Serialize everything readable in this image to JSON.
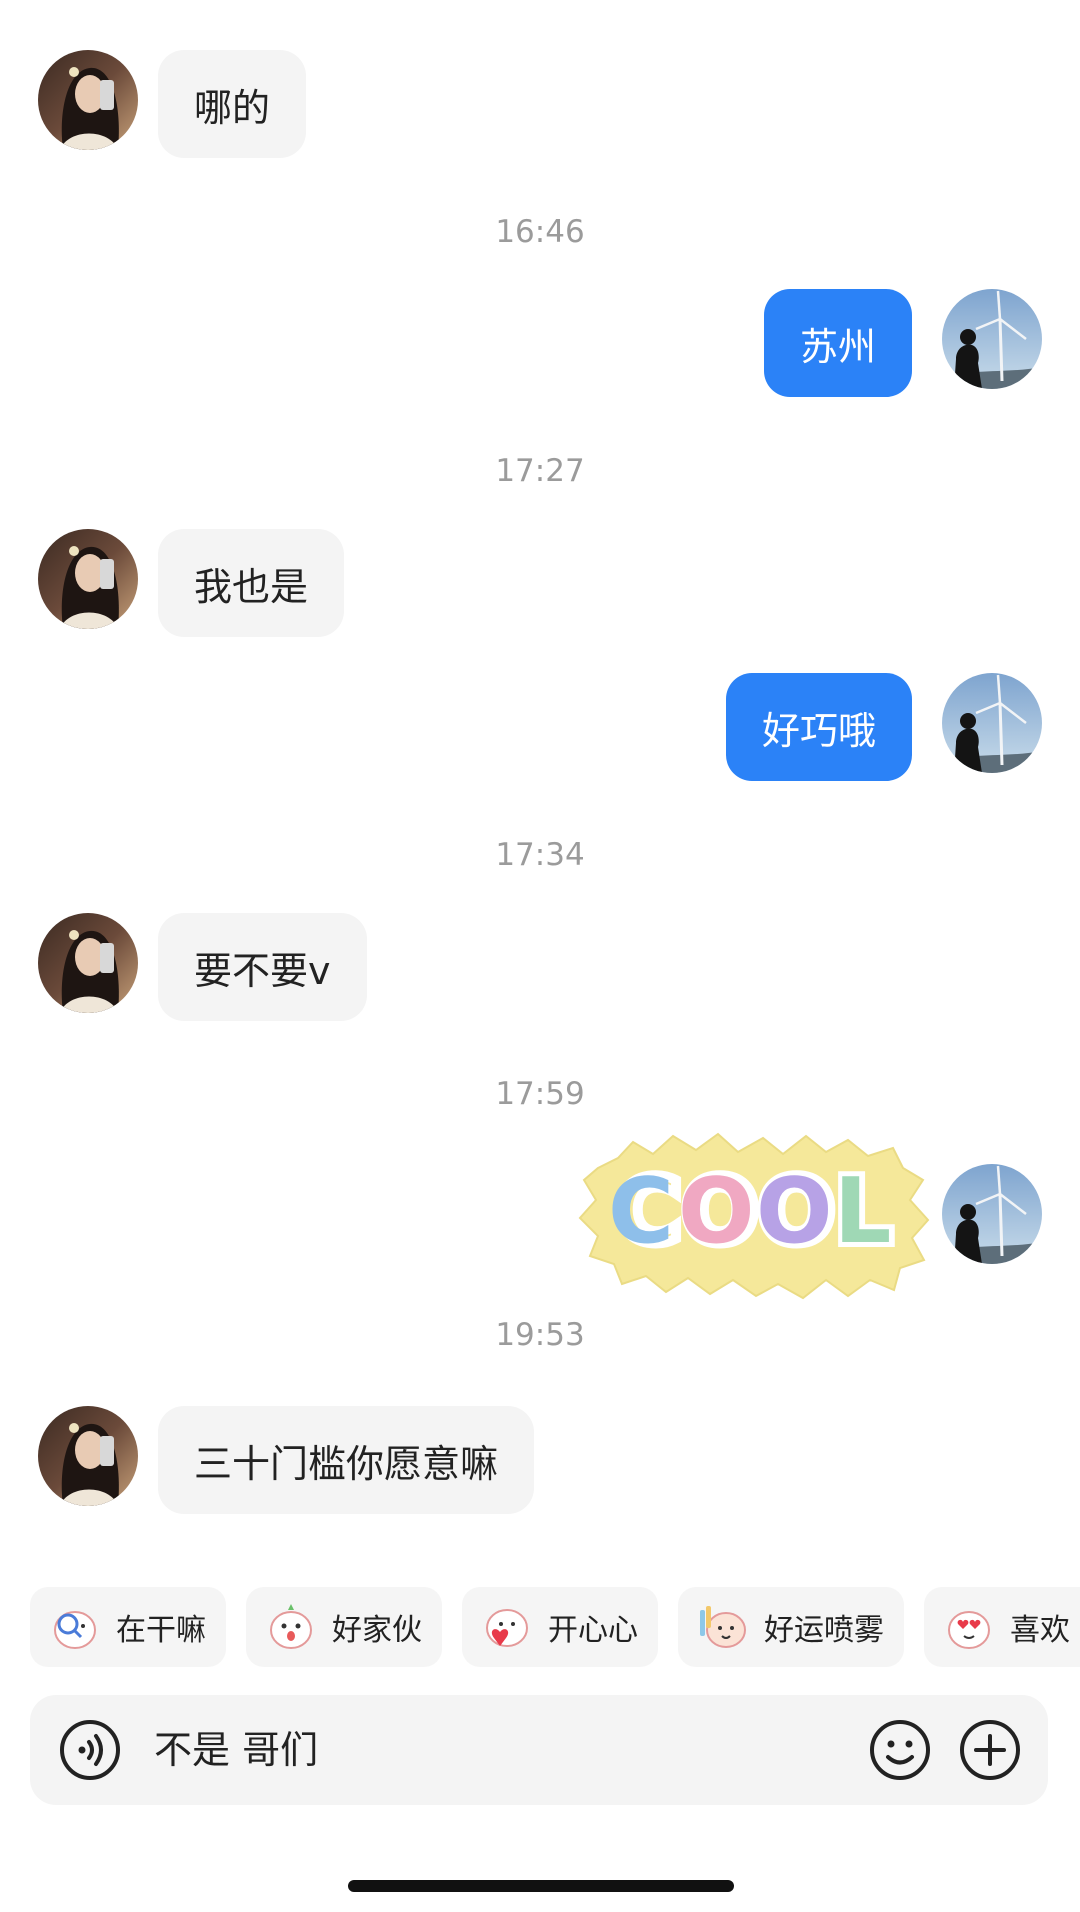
{
  "messages": [
    {
      "side": "in",
      "text": "哪的"
    },
    {
      "side": "time",
      "text": "16:46"
    },
    {
      "side": "out",
      "text": "苏州"
    },
    {
      "side": "time",
      "text": "17:27"
    },
    {
      "side": "in",
      "text": "我也是"
    },
    {
      "side": "out",
      "text": "好巧哦"
    },
    {
      "side": "time",
      "text": "17:34"
    },
    {
      "side": "in",
      "text": "要不要v"
    },
    {
      "side": "time",
      "text": "17:59"
    },
    {
      "side": "out-sticker",
      "text": "COOL"
    },
    {
      "side": "time",
      "text": "19:53"
    },
    {
      "side": "in",
      "text": "三十门槛你愿意嘛"
    }
  ],
  "quick_replies": [
    {
      "label": "在干嘛",
      "icon": "magnifier-sticker-icon"
    },
    {
      "label": "好家伙",
      "icon": "surprised-sticker-icon"
    },
    {
      "label": "开心心",
      "icon": "heart-sticker-icon"
    },
    {
      "label": "好运喷雾",
      "icon": "spray-sticker-icon"
    },
    {
      "label": "喜欢",
      "icon": "love-sticker-icon"
    }
  ],
  "input": {
    "value": "不是 哥们"
  },
  "icons": [
    "voice-icon",
    "emoji-icon",
    "plus-icon"
  ],
  "colors": {
    "outgoing_bubble": "#2b82f7",
    "incoming_bubble": "#f4f4f4",
    "timestamp": "#9b9b9b"
  }
}
